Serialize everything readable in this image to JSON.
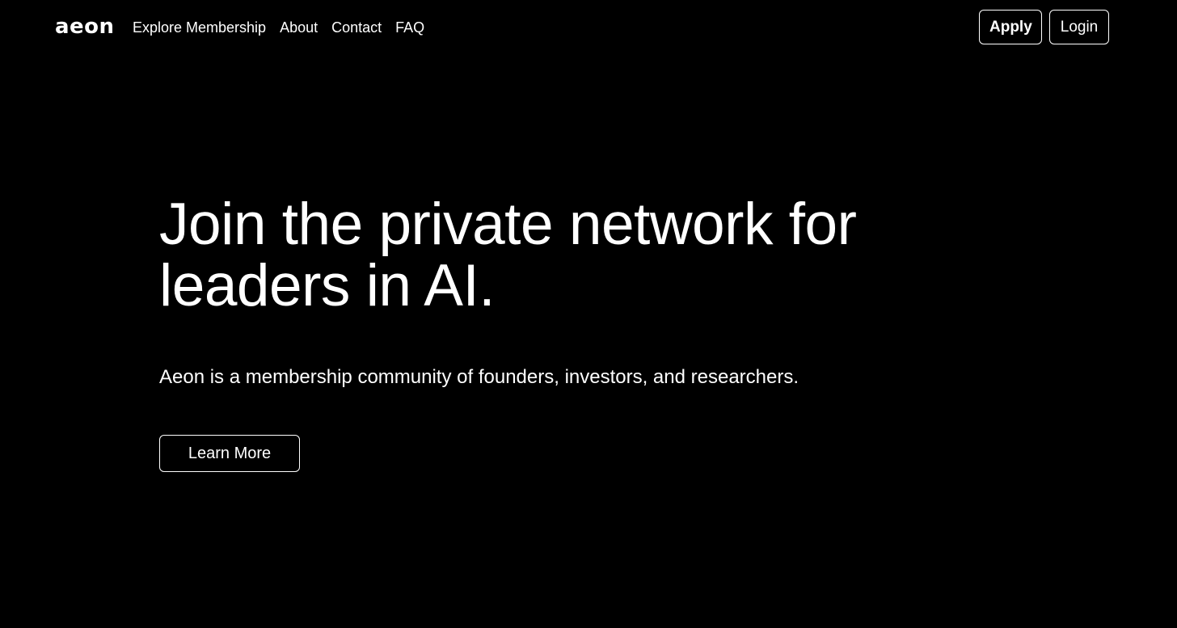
{
  "header": {
    "logo_text": "aeon",
    "nav": [
      {
        "label": "Explore Membership"
      },
      {
        "label": "About"
      },
      {
        "label": "Contact"
      },
      {
        "label": "FAQ"
      }
    ],
    "apply_label": "Apply",
    "login_label": "Login"
  },
  "hero": {
    "title": "Join the private network for leaders in AI.",
    "subtitle": "Aeon is a membership community of founders, investors, and researchers.",
    "cta_label": "Learn More"
  },
  "colors": {
    "background": "#000000",
    "text": "#ffffff",
    "border": "#ffffff"
  }
}
